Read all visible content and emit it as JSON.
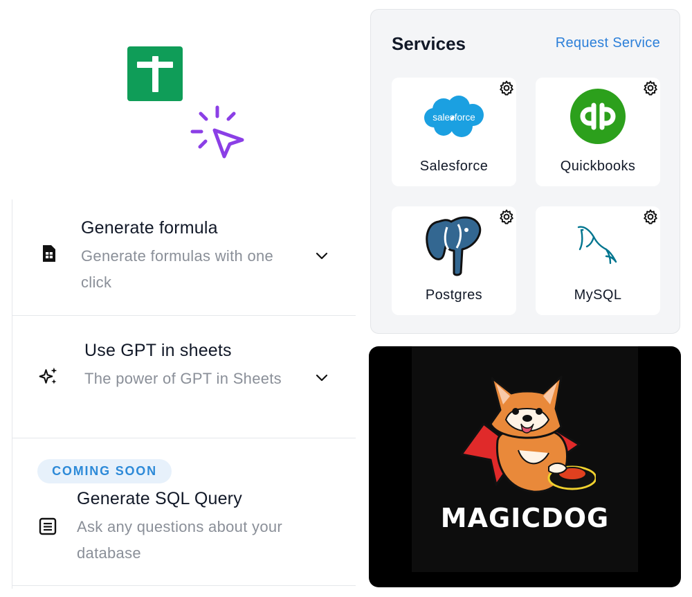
{
  "features": [
    {
      "title": "Generate formula",
      "description": "Generate formulas with one click",
      "icon": "formula-sheet-icon"
    },
    {
      "title": "Use GPT in sheets",
      "description": "The power of GPT in Sheets",
      "icon": "sparkles-icon"
    },
    {
      "badge": "COMING SOON",
      "title": "Generate SQL Query",
      "description": "Ask any questions about your database",
      "icon": "document-lines-icon"
    }
  ],
  "services": {
    "title": "Services",
    "request_label": "Request Service",
    "items": [
      {
        "label": "Salesforce",
        "logo_text": "salesforce",
        "color": "#1ba0e1"
      },
      {
        "label": "Quickbooks",
        "color": "#2ca01c"
      },
      {
        "label": "Postgres",
        "color": "#336791"
      },
      {
        "label": "MySQL",
        "color": "#00758f"
      }
    ]
  },
  "banner": {
    "wordmark": "MAGICDOG"
  },
  "colors": {
    "sheets_green": "#0f9d58",
    "accent_purple": "#8b3fe6",
    "link_blue": "#2b7fd9",
    "badge_bg": "#e7f1fb"
  }
}
